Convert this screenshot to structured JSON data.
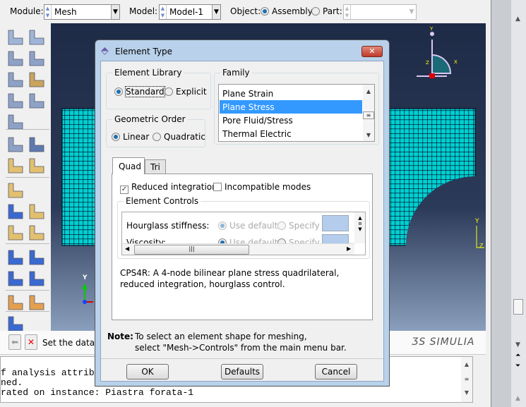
{
  "toolbar": {
    "module_label": "Module:",
    "module_value": "Mesh",
    "model_label": "Model:",
    "model_value": "Model-1",
    "object_label": "Object:",
    "object_assembly": "Assembly",
    "object_part": "Part:",
    "part_value": ""
  },
  "toolbox": {
    "icons": [
      "seed-part-icon",
      "seed-edges-icon",
      "mesh-part-icon",
      "mesh-region-icon",
      "mesh-controls-icon",
      "associate-mesh-icon",
      "assign-element-type-icon",
      "verify-mesh-icon",
      "partition-cell-icon",
      "mesh-part-instance-icon",
      "query-icon",
      "edit-mesh-icon",
      "virtual-topology-icon",
      "erase-icon",
      "create-datum-point-icon",
      "create-edge-icon",
      "partition-face-icon",
      "cut-icon",
      "create-csys-icon",
      "create-datum-axis-icon",
      "create-datum-plane-icon",
      "datum-point-icon",
      "merge-icon",
      "repair-icon",
      "query-point-icon"
    ]
  },
  "viewport": {
    "triad": {
      "y": "Y",
      "x": "X",
      "z": "Z"
    },
    "view_axis": {
      "y": "Y"
    },
    "corner_axis": {
      "y": "Y",
      "z": "Z"
    },
    "mesh_color": "#00d0d0"
  },
  "prompt": {
    "text": "Set the data u"
  },
  "logo": {
    "text": "SIMULIA"
  },
  "messages": [
    "f analysis attrib",
    "ned.",
    "rated on instance: Piastra forata-1"
  ],
  "dialog": {
    "title": "Element Type",
    "element_library": {
      "title": "Element Library",
      "options": [
        "Standard",
        "Explicit"
      ],
      "selected": "Standard"
    },
    "geometric_order": {
      "title": "Geometric Order",
      "options": [
        "Linear",
        "Quadratic"
      ],
      "selected": "Linear"
    },
    "family": {
      "title": "Family",
      "items": [
        "Plane Strain",
        "Plane Stress",
        "Pore Fluid/Stress",
        "Thermal Electric"
      ],
      "selected": "Plane Stress"
    },
    "tabs": [
      "Quad",
      "Tri"
    ],
    "active_tab": "Quad",
    "reduced_integration": {
      "label": "Reduced integration",
      "checked": true
    },
    "incompatible_modes": {
      "label": "Incompatible modes",
      "checked": false
    },
    "element_controls": {
      "title": "Element Controls",
      "rows": [
        {
          "label": "Hourglass stiffness:",
          "use_default": "Use default",
          "specify": "Specify"
        },
        {
          "label": "Viscosity:",
          "use_default": "Use default",
          "specify": "Specify"
        }
      ]
    },
    "description": "CPS4R:  A 4-node bilinear plane stress quadrilateral, reduced integration, hourglass control.",
    "note_label": "Note:",
    "note_line1": "To select an element shape for meshing,",
    "note_line2": "select \"Mesh->Controls\" from the main menu bar.",
    "buttons": {
      "ok": "OK",
      "defaults": "Defaults",
      "cancel": "Cancel"
    },
    "accent": "#3399ff"
  }
}
